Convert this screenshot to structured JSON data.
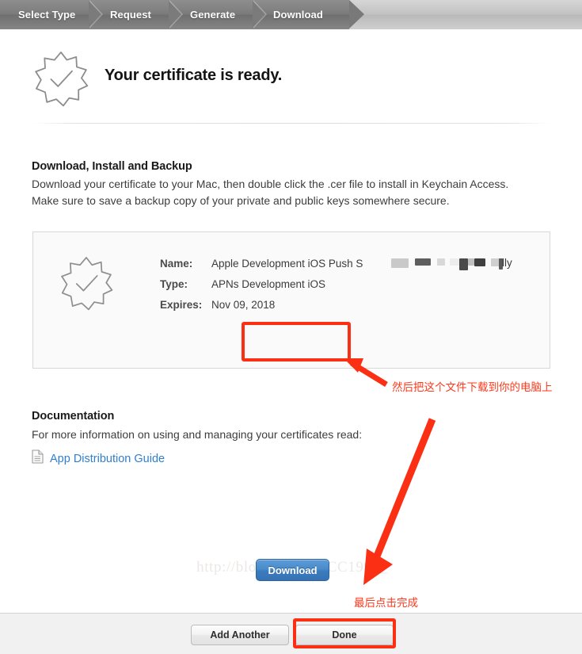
{
  "breadcrumb": {
    "steps": [
      {
        "label": "Select Type",
        "state": "done"
      },
      {
        "label": "Request",
        "state": "done"
      },
      {
        "label": "Generate",
        "state": "done"
      },
      {
        "label": "Download",
        "state": "active"
      }
    ]
  },
  "hero": {
    "title": "Your certificate is ready.",
    "badge_icon": "certificate-starburst-check-icon"
  },
  "download_section": {
    "heading": "Download, Install and Backup",
    "body": "Download your certificate to your Mac, then double click the .cer file to install in Keychain Access. Make sure to save a backup copy of your private and public keys somewhere secure."
  },
  "certificate": {
    "badge_icon": "certificate-starburst-check-icon",
    "fields": [
      {
        "label": "Name:",
        "value": "Apple Development iOS Push S"
      },
      {
        "label": "Type:",
        "value": "APNs Development iOS"
      },
      {
        "label": "Expires:",
        "value": "Nov 09, 2018"
      }
    ],
    "name_redacted_tail": "lly",
    "download_button": "Download",
    "watermark": "http://blog.csdn.net/CC1991_"
  },
  "documentation": {
    "heading": "Documentation",
    "body": "For more information on using and managing your certificates read:",
    "link_label": "App Distribution Guide",
    "link_icon": "document-page-icon"
  },
  "footer": {
    "add_another_label": "Add Another",
    "done_label": "Done"
  },
  "annotations": {
    "download_note": "然后把这个文件下载到你的电脑上",
    "done_note": "最后点击完成"
  },
  "colors": {
    "accent_blue": "#3b7cbe",
    "link_blue": "#2f7fd1",
    "annotation_red": "#fb2f14",
    "breadcrumb_active": "#797979",
    "card_bg": "#f9faf9"
  }
}
